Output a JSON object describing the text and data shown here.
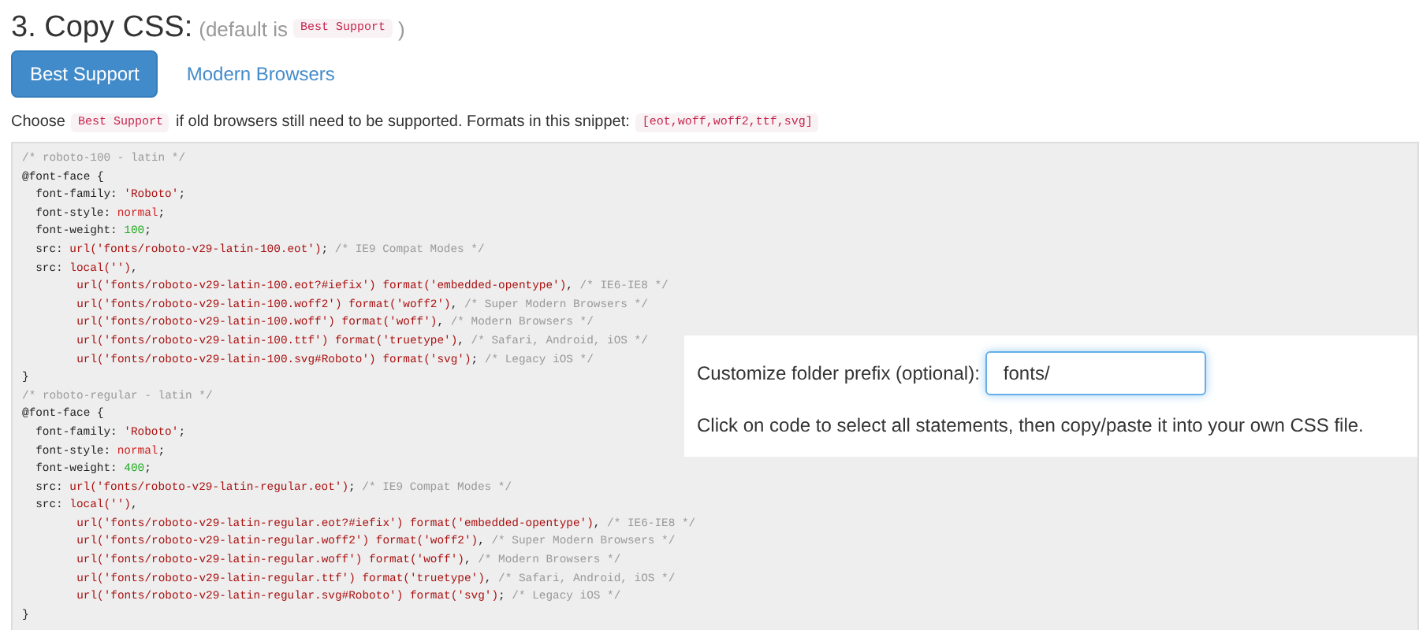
{
  "heading": {
    "title": "3. Copy CSS:",
    "note_parts": [
      {
        "kind": "text",
        "text": "(default is"
      },
      {
        "kind": "code",
        "text": "Best Support"
      },
      {
        "kind": "text",
        "text": ")"
      }
    ]
  },
  "tabs": [
    {
      "label": "Best Support",
      "selected": true
    },
    {
      "label": "Modern Browsers",
      "selected": false
    }
  ],
  "description": [
    {
      "kind": "text",
      "text": "Choose"
    },
    {
      "kind": "code",
      "text": "Best Support"
    },
    {
      "kind": "text",
      "text": "if old browsers still need to be supported. Formats in this snippet:"
    },
    {
      "kind": "code",
      "text": "[eot,woff,woff2,ttf,svg]"
    }
  ],
  "code": {
    "lines": [
      {
        "kind": "top",
        "tokens": [
          {
            "kind": "comment",
            "text": "/* roboto-100 - latin */"
          }
        ]
      },
      {
        "kind": "top",
        "tokens": [
          {
            "kind": "plain",
            "text": "@font-face {"
          }
        ]
      },
      {
        "kind": "declaration",
        "tokens": [
          {
            "kind": "plain",
            "text": "font-family: "
          },
          {
            "kind": "string",
            "text": "'Roboto'"
          },
          {
            "kind": "plain",
            "text": ";"
          }
        ]
      },
      {
        "kind": "declaration",
        "tokens": [
          {
            "kind": "plain",
            "text": "font-style: "
          },
          {
            "kind": "keyword",
            "text": "normal"
          },
          {
            "kind": "plain",
            "text": ";"
          }
        ]
      },
      {
        "kind": "declaration",
        "tokens": [
          {
            "kind": "plain",
            "text": "font-weight: "
          },
          {
            "kind": "number",
            "text": "100"
          },
          {
            "kind": "plain",
            "text": ";"
          }
        ]
      },
      {
        "kind": "declaration",
        "tokens": [
          {
            "kind": "plain",
            "text": "src: "
          },
          {
            "kind": "string",
            "text": "url('fonts/roboto-v29-latin-100.eot')"
          },
          {
            "kind": "plain",
            "text": "; "
          },
          {
            "kind": "comment",
            "text": "/* IE9 Compat Modes */"
          }
        ]
      },
      {
        "kind": "declaration",
        "tokens": [
          {
            "kind": "plain",
            "text": "src: "
          },
          {
            "kind": "string",
            "text": "local('')"
          },
          {
            "kind": "plain",
            "text": ","
          }
        ]
      },
      {
        "kind": "continuation",
        "tokens": [
          {
            "kind": "string",
            "text": "url('fonts/roboto-v29-latin-100.eot?#iefix') format('embedded-opentype')"
          },
          {
            "kind": "plain",
            "text": ", "
          },
          {
            "kind": "comment",
            "text": "/* IE6-IE8 */"
          }
        ]
      },
      {
        "kind": "continuation",
        "tokens": [
          {
            "kind": "string",
            "text": "url('fonts/roboto-v29-latin-100.woff2') format('woff2')"
          },
          {
            "kind": "plain",
            "text": ", "
          },
          {
            "kind": "comment",
            "text": "/* Super Modern Browsers */"
          }
        ]
      },
      {
        "kind": "continuation",
        "tokens": [
          {
            "kind": "string",
            "text": "url('fonts/roboto-v29-latin-100.woff') format('woff')"
          },
          {
            "kind": "plain",
            "text": ", "
          },
          {
            "kind": "comment",
            "text": "/* Modern Browsers */"
          }
        ]
      },
      {
        "kind": "continuation",
        "tokens": [
          {
            "kind": "string",
            "text": "url('fonts/roboto-v29-latin-100.ttf') format('truetype')"
          },
          {
            "kind": "plain",
            "text": ", "
          },
          {
            "kind": "comment",
            "text": "/* Safari, Android, iOS */"
          }
        ]
      },
      {
        "kind": "continuation",
        "tokens": [
          {
            "kind": "string",
            "text": "url('fonts/roboto-v29-latin-100.svg#Roboto') format('svg')"
          },
          {
            "kind": "plain",
            "text": "; "
          },
          {
            "kind": "comment",
            "text": "/* Legacy iOS */"
          }
        ]
      },
      {
        "kind": "top",
        "tokens": [
          {
            "kind": "plain",
            "text": "}"
          }
        ]
      },
      {
        "kind": "top",
        "tokens": [
          {
            "kind": "comment",
            "text": "/* roboto-regular - latin */"
          }
        ]
      },
      {
        "kind": "top",
        "tokens": [
          {
            "kind": "plain",
            "text": "@font-face {"
          }
        ]
      },
      {
        "kind": "declaration",
        "tokens": [
          {
            "kind": "plain",
            "text": "font-family: "
          },
          {
            "kind": "string",
            "text": "'Roboto'"
          },
          {
            "kind": "plain",
            "text": ";"
          }
        ]
      },
      {
        "kind": "declaration",
        "tokens": [
          {
            "kind": "plain",
            "text": "font-style: "
          },
          {
            "kind": "keyword",
            "text": "normal"
          },
          {
            "kind": "plain",
            "text": ";"
          }
        ]
      },
      {
        "kind": "declaration",
        "tokens": [
          {
            "kind": "plain",
            "text": "font-weight: "
          },
          {
            "kind": "number",
            "text": "400"
          },
          {
            "kind": "plain",
            "text": ";"
          }
        ]
      },
      {
        "kind": "declaration",
        "tokens": [
          {
            "kind": "plain",
            "text": "src: "
          },
          {
            "kind": "string",
            "text": "url('fonts/roboto-v29-latin-regular.eot')"
          },
          {
            "kind": "plain",
            "text": "; "
          },
          {
            "kind": "comment",
            "text": "/* IE9 Compat Modes */"
          }
        ]
      },
      {
        "kind": "declaration",
        "tokens": [
          {
            "kind": "plain",
            "text": "src: "
          },
          {
            "kind": "string",
            "text": "local('')"
          },
          {
            "kind": "plain",
            "text": ","
          }
        ]
      },
      {
        "kind": "continuation",
        "tokens": [
          {
            "kind": "string",
            "text": "url('fonts/roboto-v29-latin-regular.eot?#iefix') format('embedded-opentype')"
          },
          {
            "kind": "plain",
            "text": ", "
          },
          {
            "kind": "comment",
            "text": "/* IE6-IE8 */"
          }
        ]
      },
      {
        "kind": "continuation",
        "tokens": [
          {
            "kind": "string",
            "text": "url('fonts/roboto-v29-latin-regular.woff2') format('woff2')"
          },
          {
            "kind": "plain",
            "text": ", "
          },
          {
            "kind": "comment",
            "text": "/* Super Modern Browsers */"
          }
        ]
      },
      {
        "kind": "continuation",
        "tokens": [
          {
            "kind": "string",
            "text": "url('fonts/roboto-v29-latin-regular.woff') format('woff')"
          },
          {
            "kind": "plain",
            "text": ", "
          },
          {
            "kind": "comment",
            "text": "/* Modern Browsers */"
          }
        ]
      },
      {
        "kind": "continuation",
        "tokens": [
          {
            "kind": "string",
            "text": "url('fonts/roboto-v29-latin-regular.ttf') format('truetype')"
          },
          {
            "kind": "plain",
            "text": ", "
          },
          {
            "kind": "comment",
            "text": "/* Safari, Android, iOS */"
          }
        ]
      },
      {
        "kind": "continuation",
        "tokens": [
          {
            "kind": "string",
            "text": "url('fonts/roboto-v29-latin-regular.svg#Roboto') format('svg')"
          },
          {
            "kind": "plain",
            "text": "; "
          },
          {
            "kind": "comment",
            "text": "/* Legacy iOS */"
          }
        ]
      },
      {
        "kind": "top",
        "tokens": [
          {
            "kind": "plain",
            "text": "}"
          }
        ]
      }
    ]
  },
  "prefix_panel": {
    "label": "Customize folder prefix (optional):",
    "input_value": "fonts/",
    "hint": "Click on code to select all statements, then copy/paste it into your own CSS file."
  }
}
